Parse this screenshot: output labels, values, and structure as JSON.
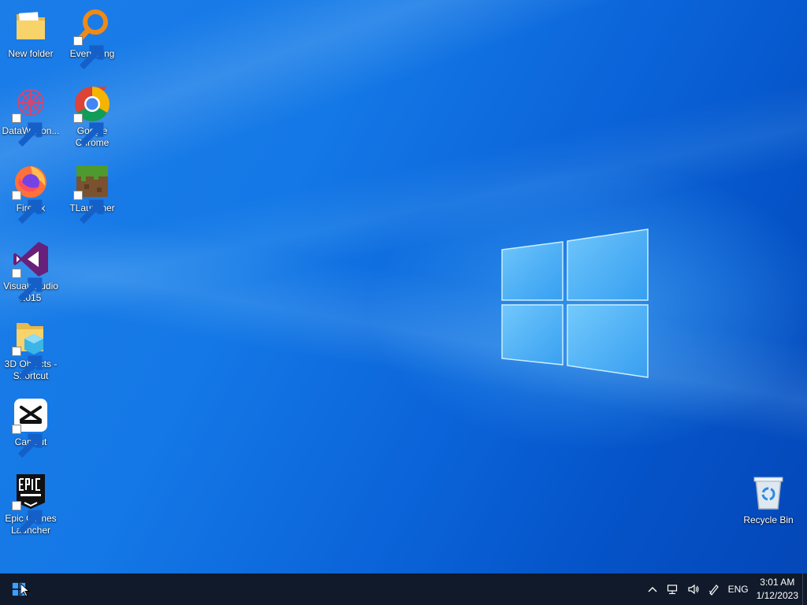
{
  "desktop": {
    "icons": [
      {
        "id": "new-folder",
        "label": "New folder"
      },
      {
        "id": "everything",
        "label": "Everything"
      },
      {
        "id": "datawagon",
        "label": "DataWagon..."
      },
      {
        "id": "google-chrome",
        "label": "Google Chrome"
      },
      {
        "id": "firefox",
        "label": "Firefox"
      },
      {
        "id": "tlauncher",
        "label": "TLauncher"
      },
      {
        "id": "visual-studio",
        "label": "Visual Studio 2015"
      },
      {
        "id": "3d-objects",
        "label": "3D Objects - Shortcut"
      },
      {
        "id": "capcut",
        "label": "CapCut"
      },
      {
        "id": "epic-games",
        "label": "Epic Games Launcher"
      },
      {
        "id": "recycle-bin",
        "label": "Recycle Bin"
      }
    ]
  },
  "taskbar": {
    "start_icon": "windows-logo-icon",
    "tray": {
      "chevron_icon": "chevron-up-icon",
      "network_icon": "network-icon",
      "volume_icon": "speaker-icon",
      "pen_icon": "pen-icon",
      "language": "ENG",
      "time": "3:01 AM",
      "date": "1/12/2023"
    }
  },
  "colors": {
    "taskbar": "#101a2a",
    "wallpaper_accent": "#1478e6"
  }
}
